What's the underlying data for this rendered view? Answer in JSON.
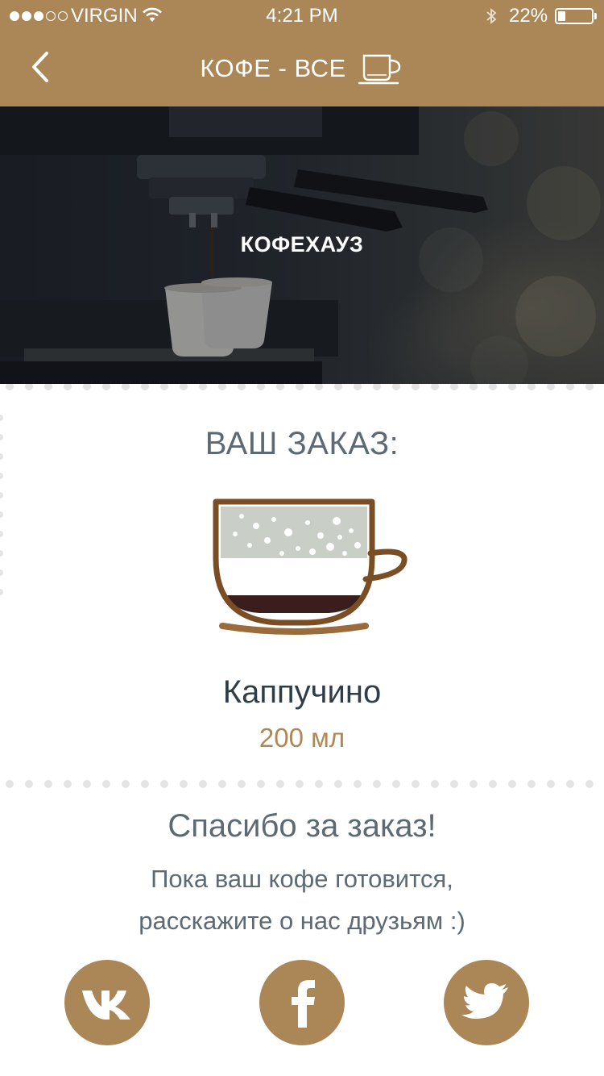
{
  "status_bar": {
    "carrier": "VIRGIN",
    "time": "4:21 PM",
    "battery_percent": "22%",
    "signal_bars_filled": 3,
    "signal_bars_total": 5,
    "battery_level": 0.22
  },
  "nav": {
    "title": "КОФЕ - ВСЕ",
    "back_icon": "chevron-left-icon",
    "title_icon": "coffee-cup-icon"
  },
  "hero": {
    "title": "КОФЕХАУЗ"
  },
  "order": {
    "label": "ВАШ ЗАКАЗ:",
    "drink_name": "Каппучино",
    "drink_volume": "200 мл",
    "illustration_icon": "cappuccino-cup-icon"
  },
  "thanks": {
    "title": "Спасибо за заказ!",
    "line1": "Пока ваш кофе готовится,",
    "line2": "расскажите о нас друзьям :)"
  },
  "social": [
    {
      "network": "vk",
      "icon": "vk-icon"
    },
    {
      "network": "facebook",
      "icon": "facebook-icon"
    },
    {
      "network": "twitter",
      "icon": "twitter-icon"
    }
  ],
  "colors": {
    "brand": "#ab8758",
    "text_primary": "#2f3e46",
    "text_secondary": "#5d6a72",
    "accent_text": "#b08858",
    "cup_outline": "#7a4e24",
    "coffee": "#3a1e1e",
    "foam": "#c9cec7"
  }
}
